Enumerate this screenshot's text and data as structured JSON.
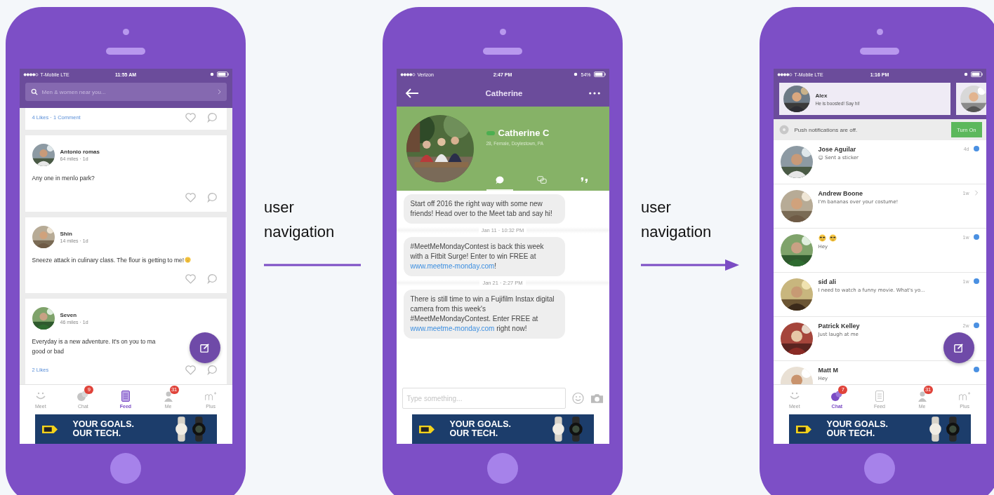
{
  "phones": [
    {
      "kind": "feed",
      "status_bar": {
        "carrier": "T-Mobile  LTE",
        "time": "11:55 AM"
      },
      "search": {
        "placeholder": "Men & women near you..."
      },
      "top_card": {
        "stats": "4 Likes · 1 Comment"
      },
      "posts": [
        {
          "name": "Antonio romas",
          "meta": "64 miles · 1d",
          "lines": [
            "Any one in menlo park?"
          ],
          "emoji": false
        },
        {
          "name": "Shin",
          "meta": "14 miles · 1d",
          "lines": [
            "Sneeze attack in culinary class. The flour is getting to me!"
          ],
          "emoji": true
        },
        {
          "name": "Seven",
          "meta": "46 miles · 1d",
          "lines": [
            "Everyday is a new adventure. It's on you to ma",
            "good or bad"
          ],
          "emoji": false,
          "stats": "2 Likes"
        }
      ],
      "tab_bar": [
        {
          "label": "Meet",
          "selected": false
        },
        {
          "label": "Chat",
          "selected": false,
          "badge": "9"
        },
        {
          "label": "Feed",
          "selected": true
        },
        {
          "label": "Me",
          "selected": false,
          "badge": "31"
        },
        {
          "label": "Plus",
          "selected": false
        }
      ],
      "ad": {
        "headline": [
          "YOUR GOALS.",
          "OUR TECH."
        ]
      }
    },
    {
      "kind": "chat",
      "status_bar": {
        "carrier": "Verizon",
        "time": "2:47 PM",
        "battery": "54%"
      },
      "title": "Catherine",
      "profile": {
        "name": "Catherine C",
        "details": "28, Female, Doylestown, PA"
      },
      "profile_tabs": [
        {
          "selected": true
        },
        {
          "selected": false
        },
        {
          "selected": false
        }
      ],
      "messages": [
        {
          "kind": "bubble",
          "parts": [
            {
              "text": "Start off 2016 the right way with some new friends! Head over to the Meet tab and say hi!",
              "link": false
            }
          ]
        },
        {
          "kind": "timestamp",
          "text": "Jan 11 · 10:32 PM"
        },
        {
          "kind": "bubble",
          "parts": [
            {
              "text": "#MeetMeMondayContest is back this week with a Fitbit Surge! Enter to win FREE at ",
              "link": false
            },
            {
              "text": "www.meetme-monday.com",
              "link": true
            },
            {
              "text": "!",
              "link": false
            }
          ]
        },
        {
          "kind": "timestamp",
          "text": "Jan 21 · 2:27 PM"
        },
        {
          "kind": "bubble",
          "parts": [
            {
              "text": "There is still time to win a Fujifilm Instax digital camera from this week's #MeetMeMondayContest. Enter FREE at ",
              "link": false
            },
            {
              "text": "www.meetme-monday.com",
              "link": true
            },
            {
              "text": " right now!",
              "link": false
            }
          ]
        }
      ],
      "composer": {
        "placeholder": "Type something..."
      },
      "ad": {
        "headline": [
          "YOUR GOALS.",
          "OUR TECH."
        ]
      }
    },
    {
      "kind": "inbox",
      "status_bar": {
        "carrier": "T-Mobile  LTE",
        "time": "1:16 PM"
      },
      "boost": {
        "name": "Alex",
        "text": "He is boosted! Say hi!"
      },
      "notice": {
        "text": "Push notifications are off.",
        "button": "Turn On"
      },
      "conversations": [
        {
          "kind": "text",
          "name": "Jose Aguilar",
          "message": "☺ Sent a sticker",
          "time": "4d",
          "unread": true
        },
        {
          "kind": "text",
          "name": "Andrew Boone",
          "message": "I'm bananas over your costume!",
          "time": "1w",
          "unread": false
        },
        {
          "kind": "emoji",
          "message": "Hey",
          "time": "1w",
          "unread": true
        },
        {
          "kind": "text",
          "name": "sid ali",
          "message": "I need to watch a funny movie. What's yo...",
          "time": "1w",
          "unread": true
        },
        {
          "kind": "text",
          "name": "Patrick Kelley",
          "message": "Just laugh at me",
          "time": "2w",
          "unread": true
        },
        {
          "kind": "text",
          "name": "Matt M",
          "message": "Hey",
          "unread": true
        }
      ],
      "tab_bar": [
        {
          "label": "Meet",
          "selected": false
        },
        {
          "label": "Chat",
          "selected": true,
          "badge": "7"
        },
        {
          "label": "Feed",
          "selected": false
        },
        {
          "label": "Me",
          "selected": false,
          "badge": "31"
        },
        {
          "label": "Plus",
          "selected": false
        }
      ],
      "ad": {
        "headline": [
          "YOUR GOALS.",
          "OUR TECH."
        ]
      }
    }
  ],
  "connectors": [
    {
      "label": "user navigation",
      "arrowhead": false
    },
    {
      "label": "user navigation",
      "arrowhead": true
    }
  ]
}
